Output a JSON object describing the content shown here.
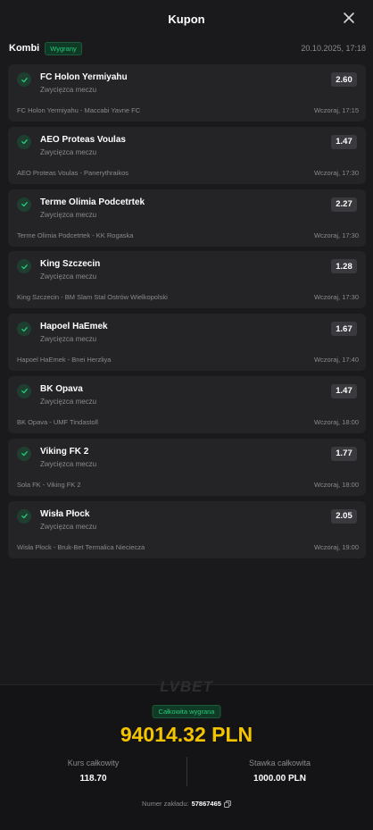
{
  "header": {
    "title": "Kupon"
  },
  "coupon": {
    "type": "Kombi",
    "status": "Wygrany",
    "date": "20.10.2025, 17:18"
  },
  "bets": [
    {
      "pick": "FC Holon Yermiyahu",
      "market": "Zwycięzca meczu",
      "odds": "2.60",
      "event": "FC Holon Yermiyahu - Maccabi Yavne FC",
      "time": "Wczoraj, 17:15"
    },
    {
      "pick": "AEO Proteas Voulas",
      "market": "Zwycięzca meczu",
      "odds": "1.47",
      "event": "AEO Proteas Voulas - Panerythraikos",
      "time": "Wczoraj, 17:30"
    },
    {
      "pick": "Terme Olimia Podcetrtek",
      "market": "Zwycięzca meczu",
      "odds": "2.27",
      "event": "Terme Olimia Podcetrtek - KK Rogaska",
      "time": "Wczoraj, 17:30"
    },
    {
      "pick": "King Szczecin",
      "market": "Zwycięzca meczu",
      "odds": "1.28",
      "event": "King Szczecin - BM Slam Stal Ostrów Wielkopolski",
      "time": "Wczoraj, 17:30"
    },
    {
      "pick": "Hapoel HaEmek",
      "market": "Zwycięzca meczu",
      "odds": "1.67",
      "event": "Hapoel HaEmek - Bnei Herzliya",
      "time": "Wczoraj, 17:40"
    },
    {
      "pick": "BK Opava",
      "market": "Zwycięzca meczu",
      "odds": "1.47",
      "event": "BK Opava - UMF Tindastoll",
      "time": "Wczoraj, 18:00"
    },
    {
      "pick": "Viking FK 2",
      "market": "Zwycięzca meczu",
      "odds": "1.77",
      "event": "Sola FK - Viking FK 2",
      "time": "Wczoraj, 18:00"
    },
    {
      "pick": "Wisła Płock",
      "market": "Zwycięzca meczu",
      "odds": "2.05",
      "event": "Wisła Płock - Bruk-Bet Termalica Nieciecza",
      "time": "Wczoraj, 19:00"
    }
  ],
  "summary": {
    "logo": "LVBET",
    "win_label": "Całkowita wygrana",
    "win_amount": "94014.32 PLN",
    "total_odds_label": "Kurs całkowity",
    "total_odds": "118.70",
    "stake_label": "Stawka całkowita",
    "stake": "1000.00 PLN",
    "ref_label": "Numer zakładu:",
    "ref_number": "57867465"
  },
  "colors": {
    "accent": "#f5c400",
    "success": "#27c97a",
    "background": "#1a1a1c",
    "card": "#242427"
  },
  "icons": {
    "close": "close-icon",
    "check": "check-icon",
    "copy": "copy-icon"
  }
}
